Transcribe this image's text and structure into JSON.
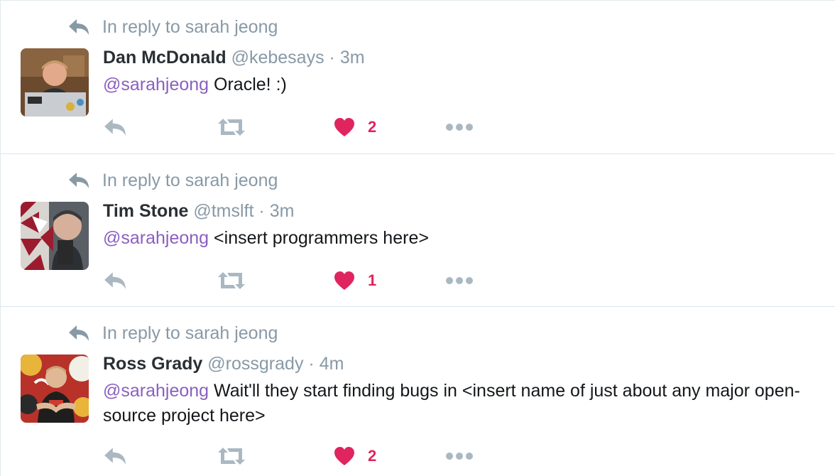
{
  "colors": {
    "muted": "#8899a6",
    "mention": "#8b5fbf",
    "like": "#e0245e",
    "divider": "#dbe4ea"
  },
  "tweets": [
    {
      "reply_context": "In reply to sarah jeong",
      "fullname": "Dan McDonald",
      "username": "@kebesays",
      "separator": "·",
      "timestamp": "3m",
      "mention": "@sarahjeong",
      "text": " Oracle!  :)",
      "like_count": "2",
      "avatar_icon": "avatar-photo-laptop"
    },
    {
      "reply_context": "In reply to sarah jeong",
      "fullname": "Tim Stone",
      "username": "@tmslft",
      "separator": "·",
      "timestamp": "3m",
      "mention": "@sarahjeong",
      "text": " <insert programmers here>",
      "like_count": "1",
      "avatar_icon": "avatar-photo-triangles"
    },
    {
      "reply_context": "In reply to sarah jeong",
      "fullname": "Ross Grady",
      "username": "@rossgrady",
      "separator": "·",
      "timestamp": "4m",
      "mention": "@sarahjeong",
      "text": " Wait'll they start finding bugs in <insert name of just about any major open-source project here>",
      "like_count": "2",
      "avatar_icon": "avatar-photo-graffiti"
    }
  ],
  "icons": {
    "reply": "reply-icon",
    "retweet": "retweet-icon",
    "like": "heart-icon",
    "more": "more-icon"
  }
}
